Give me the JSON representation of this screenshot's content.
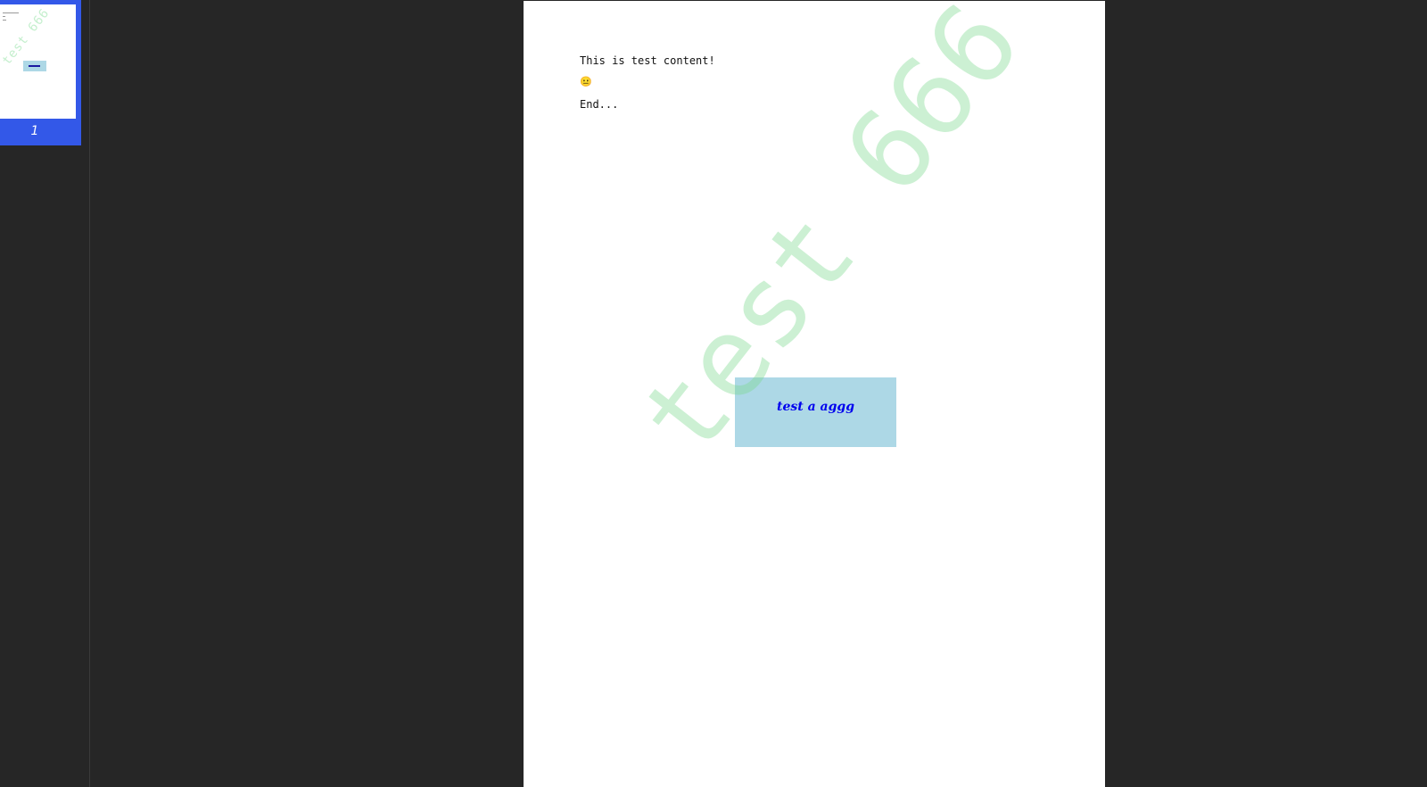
{
  "sidebar": {
    "thumbnails": [
      {
        "page_number": "1",
        "selected": true
      }
    ]
  },
  "document": {
    "lines": [
      "This is test content!",
      "😐",
      "End..."
    ],
    "text_box": {
      "label": "test a aggg",
      "background_color": "#add8e6",
      "text_color": "#0000ee"
    },
    "watermark": {
      "text": "test 666",
      "color": "#78d78c"
    }
  },
  "colors": {
    "app_background": "#262626",
    "selection_accent": "#3358e8",
    "page_background": "#ffffff"
  }
}
